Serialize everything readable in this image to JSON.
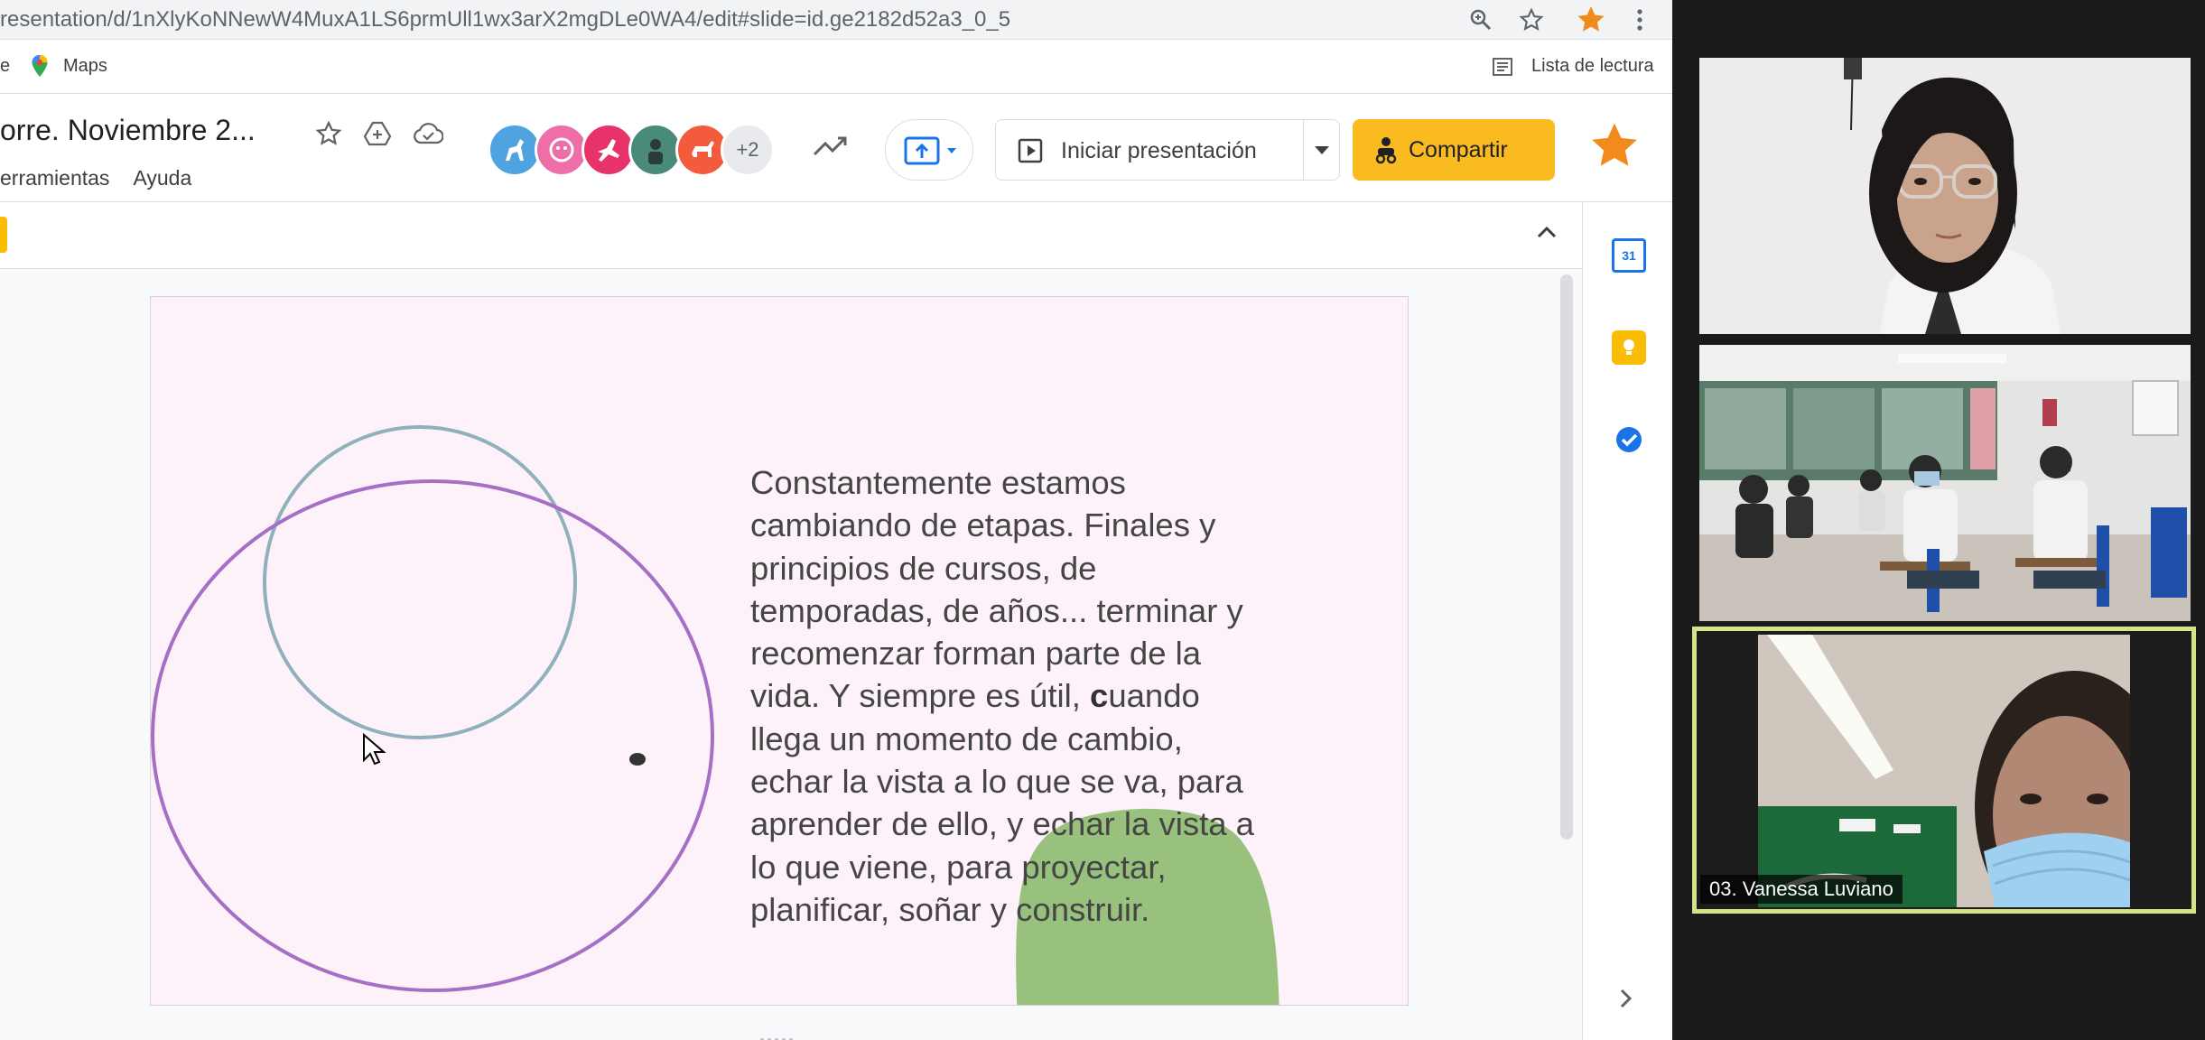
{
  "browser": {
    "url": "resentation/d/1nXlyKoNNewW4MuxA1LS6prmUll1wx3arX2mgDLe0WA4/edit#slide=id.ge2182d52a3_0_5",
    "bookmarks": {
      "left_fragment": "e",
      "maps": "Maps",
      "reading_list": "Lista de lectura"
    }
  },
  "slides": {
    "title": "orre. Noviembre 2...",
    "menu": [
      "erramientas",
      "Ayuda"
    ],
    "collaborators_extra": "+2",
    "present_label": "Iniciar presentación",
    "share_label": "Compartir",
    "calendar_day": "31"
  },
  "slide": {
    "text_lines": [
      "Constantemente estamos",
      "cambiando de etapas. Finales y",
      "principios de cursos, de",
      "temporadas, de años... terminar y",
      "recomenzar forman parte de la",
      "vida. Y siempre es útil, "
    ],
    "bold_char": "c",
    "line6_rest": "uando",
    "text_lines_after": [
      "llega un momento de cambio,",
      "echar la vista a lo que se va, para",
      "aprender de ello, y echar la vista a",
      "lo que viene, para proyectar,",
      "planificar, soñar y construir."
    ]
  },
  "video": {
    "participant_name": "03. Vanessa Luviano"
  },
  "colors": {
    "accent_share": "#f9bb1f",
    "star": "#f28b1e",
    "slide_bg": "#fdf1fa",
    "circle_teal": "#8fb1bb",
    "circle_purple": "#a66fc6",
    "green_shape": "#97c17d",
    "active_tile_border": "#d8e28a"
  }
}
